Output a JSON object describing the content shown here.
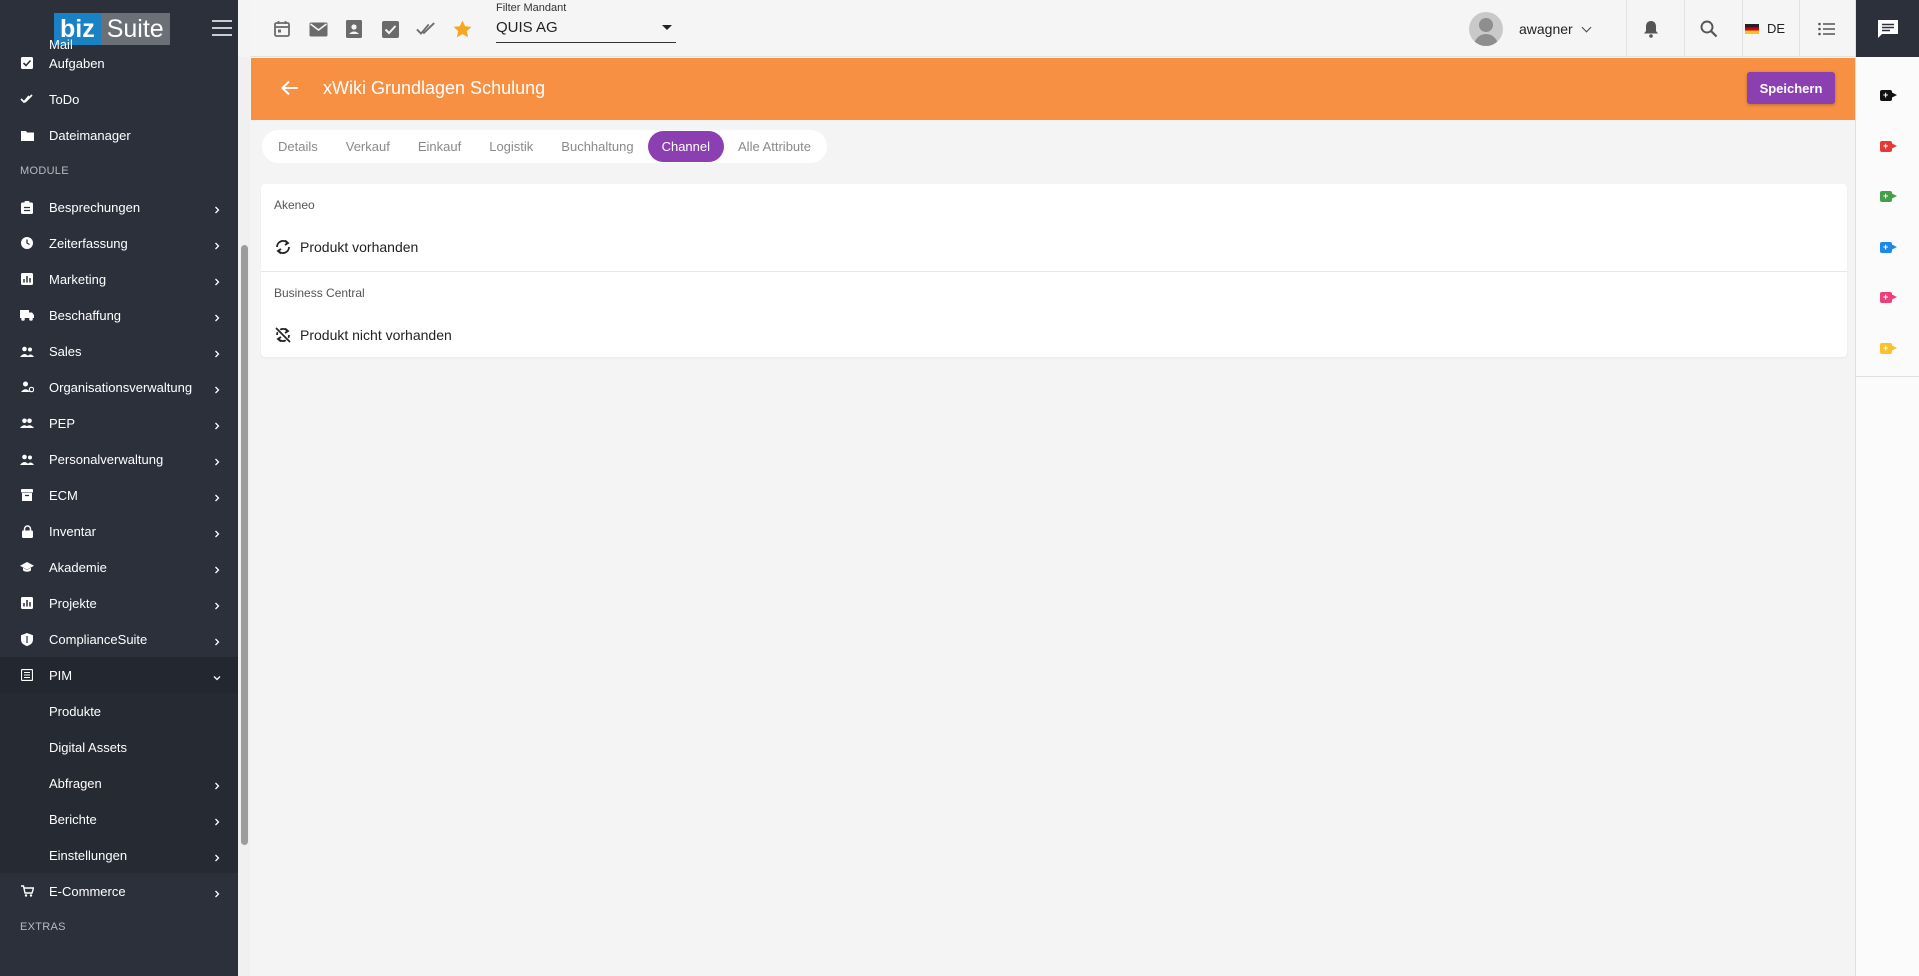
{
  "app": {
    "logo_biz": "biz",
    "logo_suite": "Suite"
  },
  "sidebar": {
    "items_top": [
      {
        "label": "Mail",
        "icon": "mail-icon"
      },
      {
        "label": "Aufgaben",
        "icon": "checkbox-icon"
      },
      {
        "label": "ToDo",
        "icon": "check-icon"
      },
      {
        "label": "Dateimanager",
        "icon": "folder-icon"
      }
    ],
    "module_heading": "MODULE",
    "modules": [
      {
        "label": "Besprechungen",
        "icon": "clipboard-icon"
      },
      {
        "label": "Zeiterfassung",
        "icon": "clock-icon"
      },
      {
        "label": "Marketing",
        "icon": "chart-icon"
      },
      {
        "label": "Beschaffung",
        "icon": "truck-icon"
      },
      {
        "label": "Sales",
        "icon": "people-icon"
      },
      {
        "label": "Organisationsverwaltung",
        "icon": "org-icon"
      },
      {
        "label": "PEP",
        "icon": "group-icon"
      },
      {
        "label": "Personalverwaltung",
        "icon": "people-icon"
      },
      {
        "label": "ECM",
        "icon": "archive-icon"
      },
      {
        "label": "Inventar",
        "icon": "lock-icon"
      },
      {
        "label": "Akademie",
        "icon": "school-icon"
      },
      {
        "label": "Projekte",
        "icon": "chart-icon"
      },
      {
        "label": "ComplianceSuite",
        "icon": "shield-icon"
      }
    ],
    "pim": {
      "label": "PIM",
      "icon": "list-icon",
      "children": [
        {
          "label": "Produkte",
          "has_chevron": false
        },
        {
          "label": "Digital Assets",
          "has_chevron": false
        },
        {
          "label": "Abfragen",
          "has_chevron": true
        },
        {
          "label": "Berichte",
          "has_chevron": true
        },
        {
          "label": "Einstellungen",
          "has_chevron": true
        }
      ]
    },
    "ecommerce": {
      "label": "E-Commerce",
      "icon": "cart-icon"
    },
    "extras_heading": "EXTRAS"
  },
  "topbar": {
    "icons": [
      "calendar-icon",
      "mail-icon",
      "contacts-icon",
      "checkbox-icon",
      "done-all-icon",
      "star-icon"
    ],
    "star_color": "#f5a623",
    "filter_label": "Filter Mandant",
    "filter_value": "QUIS AG",
    "username": "awagner",
    "language": "DE"
  },
  "header": {
    "title": "xWiki Grundlagen Schulung",
    "save_label": "Speichern",
    "bar_color": "#f79042",
    "accent_color": "#8b3fb0"
  },
  "tabs": [
    {
      "label": "Details",
      "active": false
    },
    {
      "label": "Verkauf",
      "active": false
    },
    {
      "label": "Einkauf",
      "active": false
    },
    {
      "label": "Logistik",
      "active": false
    },
    {
      "label": "Buchhaltung",
      "active": false
    },
    {
      "label": "Channel",
      "active": true
    },
    {
      "label": "Alle Attribute",
      "active": false
    }
  ],
  "channels": [
    {
      "name": "Akeneo",
      "status": "Produkt vorhanden",
      "icon": "sync-icon"
    },
    {
      "name": "Business Central",
      "status": "Produkt nicht vorhanden",
      "icon": "sync-disabled-icon"
    }
  ],
  "right_rail": {
    "cam_colors": [
      "#111111",
      "#e53935",
      "#43a047",
      "#1e88e5",
      "#ec407a",
      "#fbc02d"
    ]
  }
}
